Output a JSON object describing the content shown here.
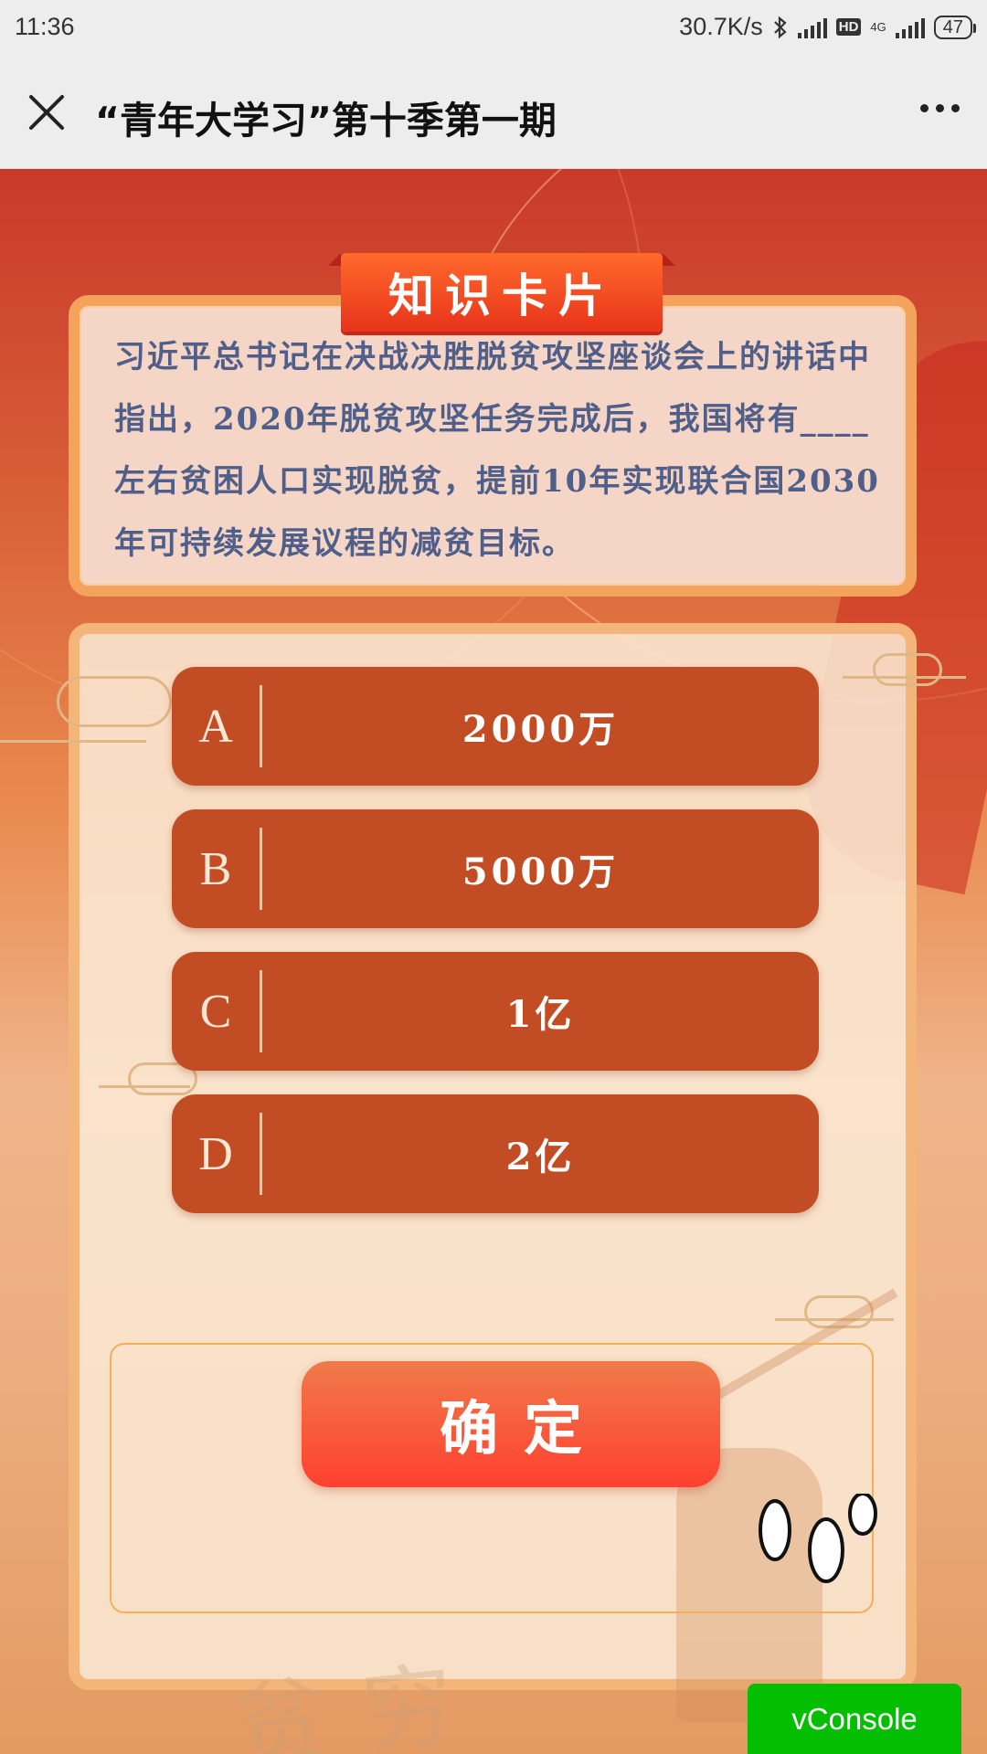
{
  "status_bar": {
    "time": "11:36",
    "net_speed": "30.7K/s",
    "hd": "HD",
    "network": "4G",
    "battery": "47",
    "icons": [
      "bluetooth-icon",
      "signal-icon",
      "hd-icon",
      "4g-signal-icon",
      "battery-icon"
    ]
  },
  "header": {
    "title": "“青年大学习”第十季第一期",
    "close_icon": "close-icon",
    "more_icon": "more-icon"
  },
  "card": {
    "banner": "知识卡片",
    "question": "习近平总书记在决战决胜脱贫攻坚座谈会上的讲话中指出，2020年脱贫攻坚任务完成后，我国将有____左右贫困人口实现脱贫，提前10年实现联合国2030年可持续发展议程的减贫目标。"
  },
  "options": [
    {
      "letter": "A",
      "text": "2000万"
    },
    {
      "letter": "B",
      "text": "5000万"
    },
    {
      "letter": "C",
      "text": "1亿"
    },
    {
      "letter": "D",
      "text": "2亿"
    }
  ],
  "confirm_label": "确定",
  "watermark": "贫穷",
  "vconsole_label": "vConsole",
  "colors": {
    "option_bg": "#c24d24",
    "confirm_bg": "#ff4a33",
    "card_border": "#f3a35b",
    "question_text": "#4f5f8a",
    "vconsole_bg": "#04be02"
  }
}
